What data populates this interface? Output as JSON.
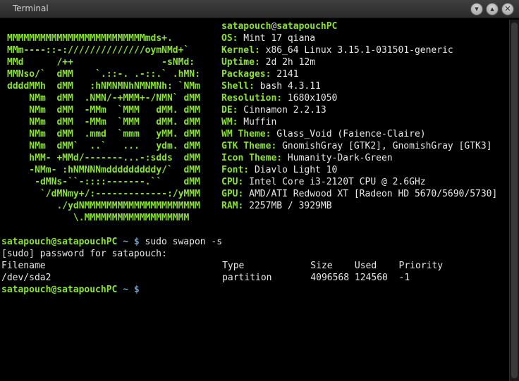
{
  "window": {
    "title": "Terminal",
    "minimize_glyph": "▾",
    "maximize_glyph": "▴",
    "close_glyph": "✕"
  },
  "logo": [
    "MMMMMMMMMMMMMMMMMMMMMMMMMmds+.",
    "MMm----::-://////////////oymNMd+`",
    "MMd      /++                -sNMd:",
    "MMNso/`  dMM    `.::-. .-::.` .hMN:",
    "ddddMMh  dMM   :hNMNMNhNMNMNh: `NMm",
    "    NMm  dMM  .NMN/-+MMM+-/NMN` dMM",
    "    NMm  dMM  -MMm  `MMM   dMM. dMM",
    "    NMm  dMM  -MMm  `MMM   dMM. dMM",
    "    NMm  dMM  .mmd  `mmm   yMM. dMM",
    "    NMm  dMM`  ..`   ...   ydm. dMM",
    "    hMM- +MMd/-------...-:sdds  dMM",
    "    -NMm- :hNMNNNmdddddddddy/`  dMM",
    "     -dMNs-``-::::-------.``    dMM",
    "      `/dMNmy+/:-------------:/yMMM",
    "         ./ydNMMMMMMMMMMMMMMMMMMMMM",
    "            \\.MMMMMMMMMMMMMMMMMMM"
  ],
  "sysinfo": {
    "user": "satapouch",
    "at": "@",
    "host": "satapouchPC",
    "rows": [
      {
        "key": "OS:",
        "value": " Mint 17 qiana"
      },
      {
        "key": "Kernel:",
        "value": " x86_64 Linux 3.15.1-031501-generic"
      },
      {
        "key": "Uptime:",
        "value": " 2d 2h 12m"
      },
      {
        "key": "Packages:",
        "value": " 2141"
      },
      {
        "key": "Shell:",
        "value": " bash 4.3.11"
      },
      {
        "key": "Resolution:",
        "value": " 1680x1050"
      },
      {
        "key": "DE:",
        "value": " Cinnamon 2.2.13"
      },
      {
        "key": "WM:",
        "value": " Muffin"
      },
      {
        "key": "WM Theme:",
        "value": " Glass_Void (Faience-Claire)"
      },
      {
        "key": "GTK Theme:",
        "value": " GnomishGray [GTK2], GnomishGray [GTK3]"
      },
      {
        "key": "Icon Theme:",
        "value": " Humanity-Dark-Green"
      },
      {
        "key": "Font:",
        "value": " Diavlo Light 10"
      },
      {
        "key": "CPU:",
        "value": " Intel Core i3-2120T CPU @ 2.6GHz"
      },
      {
        "key": "GPU:",
        "value": " AMD/ATI Redwood XT [Radeon HD 5670/5690/5730]"
      },
      {
        "key": "RAM:",
        "value": " 2257MB / 3929MB"
      }
    ]
  },
  "session": {
    "prompt_user_host": "satapouch@satapouchPC",
    "prompt_path": " ~ $",
    "command": " sudo swapon -s",
    "sudo_prompt": "[sudo] password for satapouch:",
    "swap_header": "Filename                                Type            Size    Used    Priority",
    "swap_row": "/dev/sda2                               partition       4096568 124560  -1",
    "final_prompt_user_host": "satapouch@satapouchPC",
    "final_prompt_path": " ~ $"
  },
  "colors": {
    "accent_green": "#8ae234",
    "prompt_blue": "#729fcf",
    "text": "#e8e8e8",
    "background": "#000000"
  }
}
